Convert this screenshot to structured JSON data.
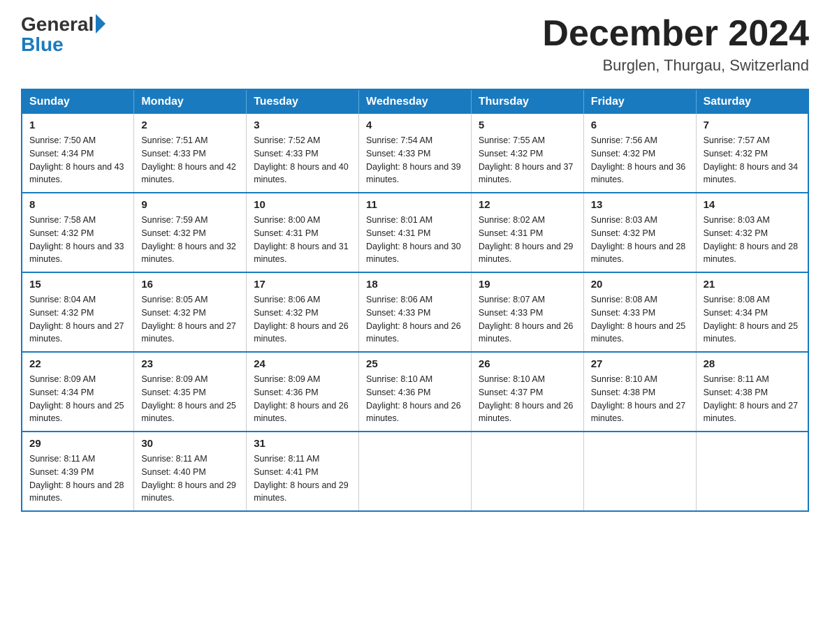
{
  "logo": {
    "general": "General",
    "blue": "Blue"
  },
  "title": {
    "month_year": "December 2024",
    "location": "Burglen, Thurgau, Switzerland"
  },
  "headers": [
    "Sunday",
    "Monday",
    "Tuesday",
    "Wednesday",
    "Thursday",
    "Friday",
    "Saturday"
  ],
  "weeks": [
    [
      {
        "day": "1",
        "sunrise": "7:50 AM",
        "sunset": "4:34 PM",
        "daylight": "8 hours and 43 minutes."
      },
      {
        "day": "2",
        "sunrise": "7:51 AM",
        "sunset": "4:33 PM",
        "daylight": "8 hours and 42 minutes."
      },
      {
        "day": "3",
        "sunrise": "7:52 AM",
        "sunset": "4:33 PM",
        "daylight": "8 hours and 40 minutes."
      },
      {
        "day": "4",
        "sunrise": "7:54 AM",
        "sunset": "4:33 PM",
        "daylight": "8 hours and 39 minutes."
      },
      {
        "day": "5",
        "sunrise": "7:55 AM",
        "sunset": "4:32 PM",
        "daylight": "8 hours and 37 minutes."
      },
      {
        "day": "6",
        "sunrise": "7:56 AM",
        "sunset": "4:32 PM",
        "daylight": "8 hours and 36 minutes."
      },
      {
        "day": "7",
        "sunrise": "7:57 AM",
        "sunset": "4:32 PM",
        "daylight": "8 hours and 34 minutes."
      }
    ],
    [
      {
        "day": "8",
        "sunrise": "7:58 AM",
        "sunset": "4:32 PM",
        "daylight": "8 hours and 33 minutes."
      },
      {
        "day": "9",
        "sunrise": "7:59 AM",
        "sunset": "4:32 PM",
        "daylight": "8 hours and 32 minutes."
      },
      {
        "day": "10",
        "sunrise": "8:00 AM",
        "sunset": "4:31 PM",
        "daylight": "8 hours and 31 minutes."
      },
      {
        "day": "11",
        "sunrise": "8:01 AM",
        "sunset": "4:31 PM",
        "daylight": "8 hours and 30 minutes."
      },
      {
        "day": "12",
        "sunrise": "8:02 AM",
        "sunset": "4:31 PM",
        "daylight": "8 hours and 29 minutes."
      },
      {
        "day": "13",
        "sunrise": "8:03 AM",
        "sunset": "4:32 PM",
        "daylight": "8 hours and 28 minutes."
      },
      {
        "day": "14",
        "sunrise": "8:03 AM",
        "sunset": "4:32 PM",
        "daylight": "8 hours and 28 minutes."
      }
    ],
    [
      {
        "day": "15",
        "sunrise": "8:04 AM",
        "sunset": "4:32 PM",
        "daylight": "8 hours and 27 minutes."
      },
      {
        "day": "16",
        "sunrise": "8:05 AM",
        "sunset": "4:32 PM",
        "daylight": "8 hours and 27 minutes."
      },
      {
        "day": "17",
        "sunrise": "8:06 AM",
        "sunset": "4:32 PM",
        "daylight": "8 hours and 26 minutes."
      },
      {
        "day": "18",
        "sunrise": "8:06 AM",
        "sunset": "4:33 PM",
        "daylight": "8 hours and 26 minutes."
      },
      {
        "day": "19",
        "sunrise": "8:07 AM",
        "sunset": "4:33 PM",
        "daylight": "8 hours and 26 minutes."
      },
      {
        "day": "20",
        "sunrise": "8:08 AM",
        "sunset": "4:33 PM",
        "daylight": "8 hours and 25 minutes."
      },
      {
        "day": "21",
        "sunrise": "8:08 AM",
        "sunset": "4:34 PM",
        "daylight": "8 hours and 25 minutes."
      }
    ],
    [
      {
        "day": "22",
        "sunrise": "8:09 AM",
        "sunset": "4:34 PM",
        "daylight": "8 hours and 25 minutes."
      },
      {
        "day": "23",
        "sunrise": "8:09 AM",
        "sunset": "4:35 PM",
        "daylight": "8 hours and 25 minutes."
      },
      {
        "day": "24",
        "sunrise": "8:09 AM",
        "sunset": "4:36 PM",
        "daylight": "8 hours and 26 minutes."
      },
      {
        "day": "25",
        "sunrise": "8:10 AM",
        "sunset": "4:36 PM",
        "daylight": "8 hours and 26 minutes."
      },
      {
        "day": "26",
        "sunrise": "8:10 AM",
        "sunset": "4:37 PM",
        "daylight": "8 hours and 26 minutes."
      },
      {
        "day": "27",
        "sunrise": "8:10 AM",
        "sunset": "4:38 PM",
        "daylight": "8 hours and 27 minutes."
      },
      {
        "day": "28",
        "sunrise": "8:11 AM",
        "sunset": "4:38 PM",
        "daylight": "8 hours and 27 minutes."
      }
    ],
    [
      {
        "day": "29",
        "sunrise": "8:11 AM",
        "sunset": "4:39 PM",
        "daylight": "8 hours and 28 minutes."
      },
      {
        "day": "30",
        "sunrise": "8:11 AM",
        "sunset": "4:40 PM",
        "daylight": "8 hours and 29 minutes."
      },
      {
        "day": "31",
        "sunrise": "8:11 AM",
        "sunset": "4:41 PM",
        "daylight": "8 hours and 29 minutes."
      },
      null,
      null,
      null,
      null
    ]
  ]
}
